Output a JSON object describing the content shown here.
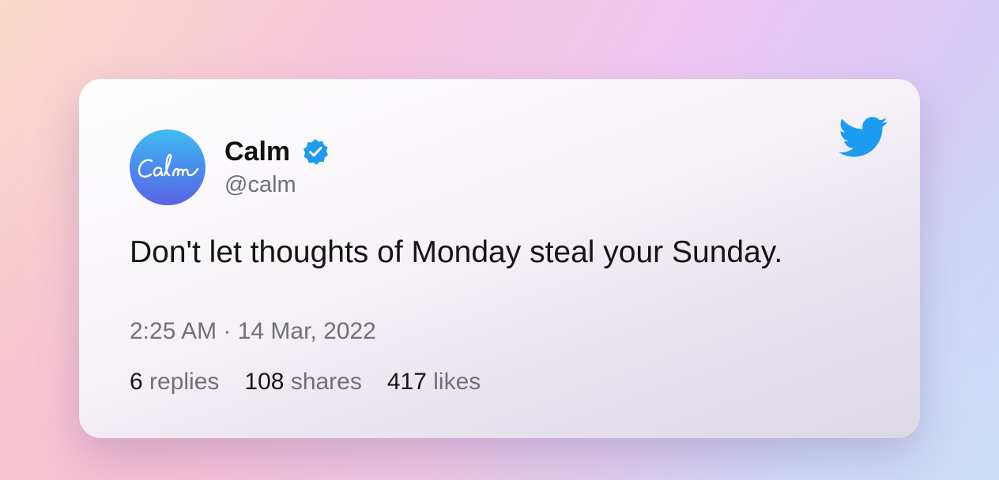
{
  "tweet": {
    "author_name": "Calm",
    "handle": "@calm",
    "avatar_text": "Calm",
    "verified_icon": "verified-badge-icon",
    "platform_icon": "twitter-bird-icon",
    "text": "Don't let thoughts of Monday steal your Sunday.",
    "timestamp": "2:25 AM · 14 Mar, 2022",
    "stats": [
      {
        "count": "6",
        "label": "replies"
      },
      {
        "count": "108",
        "label": "shares"
      },
      {
        "count": "417",
        "label": "likes"
      }
    ]
  },
  "colors": {
    "twitter_blue": "#1d9bf0",
    "verified_blue": "#1d9bf0",
    "avatar_top": "#3fbdf1",
    "avatar_bottom": "#5c63e6"
  }
}
